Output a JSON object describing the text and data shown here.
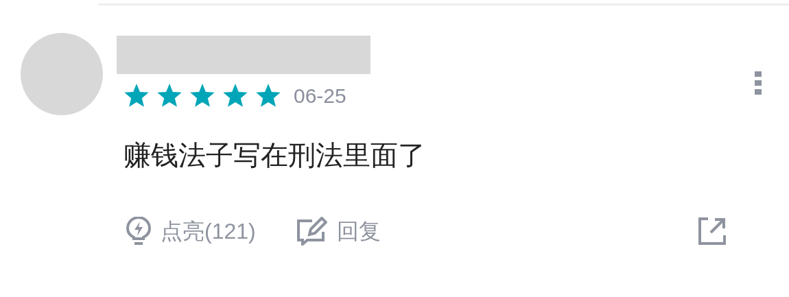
{
  "review": {
    "stars": 5,
    "date": "06-25",
    "text": "赚钱法子写在刑法里面了",
    "actions": [
      {
        "kind": "light",
        "label": "点亮(121)"
      },
      {
        "kind": "reply",
        "label": "回复"
      }
    ]
  }
}
